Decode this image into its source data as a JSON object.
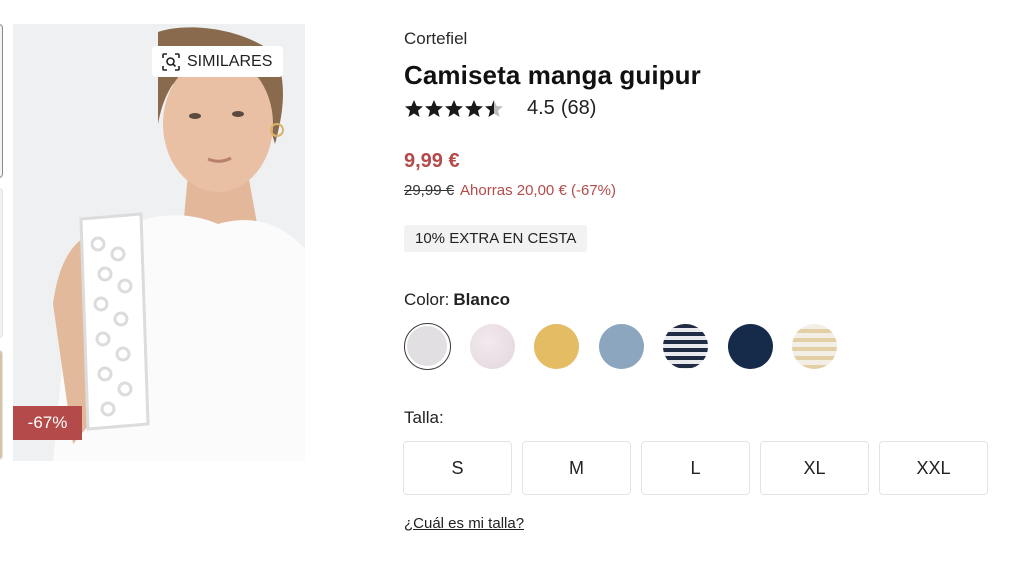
{
  "gallery": {
    "similar_label": "SIMILARES",
    "discount_badge": "-67%"
  },
  "product": {
    "brand": "Cortefiel",
    "title": "Camiseta manga guipur",
    "rating_value": "4.5",
    "rating_count": "(68)",
    "rating_stars": 4.5,
    "price": "9,99 €",
    "old_price": "29,99 €",
    "savings": "Ahorras 20,00 € (-67%)",
    "promo": "10% EXTRA EN CESTA"
  },
  "colors": {
    "label": "Color:",
    "selected_name": "Blanco",
    "swatches": [
      {
        "color": "#e2dfe2",
        "selected": true
      },
      {
        "color": "#e8dde2",
        "selected": false
      },
      {
        "color": "#e3bc64",
        "selected": false
      },
      {
        "color": "#8ca6bf",
        "selected": false
      },
      {
        "color": "striped-navy-white",
        "selected": false
      },
      {
        "color": "#162a4a",
        "selected": false
      },
      {
        "color": "striped-beige-white",
        "selected": false
      }
    ]
  },
  "sizes": {
    "label": "Talla:",
    "options": [
      "S",
      "M",
      "L",
      "XL",
      "XXL"
    ],
    "guide_link": "¿Cuál es mi talla?"
  },
  "theme": {
    "accent": "#b54a4a",
    "star_color": "#1a1a1a"
  }
}
